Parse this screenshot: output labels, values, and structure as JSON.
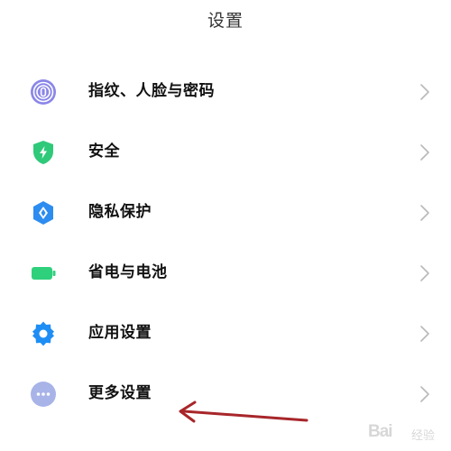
{
  "header": {
    "title": "设置"
  },
  "settings": {
    "items": [
      {
        "label": "指纹、人脸与密码",
        "icon": "fingerprint-icon",
        "color": "#8a86e8"
      },
      {
        "label": "安全",
        "icon": "shield-icon",
        "color": "#2fc97a"
      },
      {
        "label": "隐私保护",
        "icon": "privacy-icon",
        "color": "#2d8cf0"
      },
      {
        "label": "省电与电池",
        "icon": "battery-icon",
        "color": "#2fd07c"
      },
      {
        "label": "应用设置",
        "icon": "gear-icon",
        "color": "#1e8ef5"
      },
      {
        "label": "更多设置",
        "icon": "more-icon",
        "color": "#a8b3e8"
      }
    ]
  },
  "annotation": {
    "arrow_color": "#a8262a"
  },
  "watermark": {
    "text": "Bai",
    "sub": "经验"
  }
}
